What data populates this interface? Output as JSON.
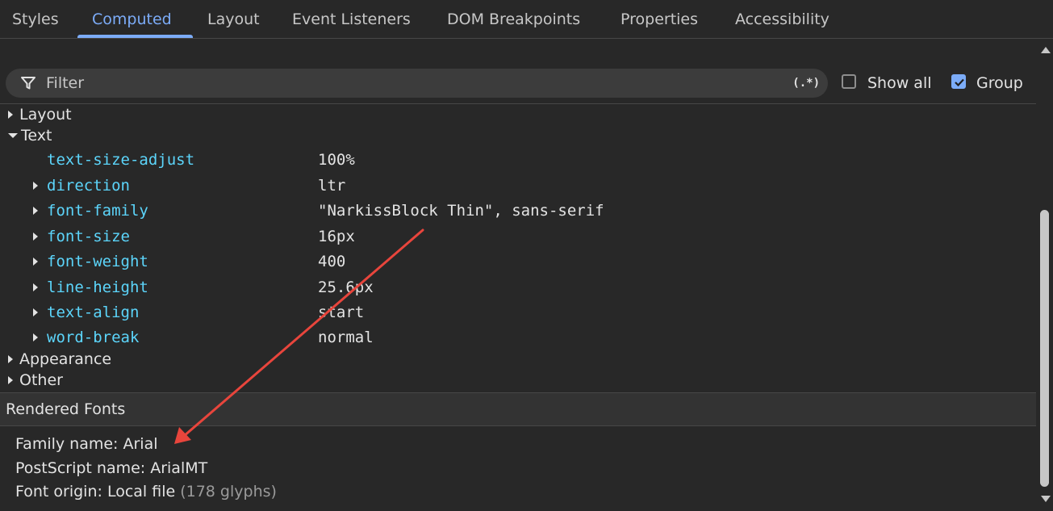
{
  "tabs": [
    {
      "label": "Styles",
      "active": false
    },
    {
      "label": "Computed",
      "active": true
    },
    {
      "label": "Layout",
      "active": false
    },
    {
      "label": "Event Listeners",
      "active": false
    },
    {
      "label": "DOM Breakpoints",
      "active": false
    },
    {
      "label": "Properties",
      "active": false
    },
    {
      "label": "Accessibility",
      "active": false
    }
  ],
  "filter": {
    "placeholder": "Filter",
    "regex_label": "(.*)",
    "filter_icon": "funnel-icon"
  },
  "show_all": {
    "label": "Show all",
    "checked": false
  },
  "group": {
    "label": "Group",
    "checked": true
  },
  "groups": {
    "layout": {
      "label": "Layout",
      "expanded": false
    },
    "text": {
      "label": "Text",
      "expanded": true
    },
    "appearance": {
      "label": "Appearance",
      "expanded": false
    },
    "other": {
      "label": "Other",
      "expanded": false
    }
  },
  "text_properties": [
    {
      "name": "text-size-adjust",
      "value": "100%",
      "expandable": false
    },
    {
      "name": "direction",
      "value": "ltr",
      "expandable": true
    },
    {
      "name": "font-family",
      "value": "\"NarkissBlock Thin\", sans-serif",
      "expandable": true
    },
    {
      "name": "font-size",
      "value": "16px",
      "expandable": true
    },
    {
      "name": "font-weight",
      "value": "400",
      "expandable": true
    },
    {
      "name": "line-height",
      "value": "25.6px",
      "expandable": true
    },
    {
      "name": "text-align",
      "value": "start",
      "expandable": true
    },
    {
      "name": "word-break",
      "value": "normal",
      "expandable": true
    }
  ],
  "rendered_fonts": {
    "title": "Rendered Fonts",
    "family_name": "Family name: Arial",
    "postscript_name": "PostScript name: ArialMT",
    "font_origin": "Font origin: Local file",
    "glyph_count": "(178 glyphs)"
  },
  "colors": {
    "background": "#282828",
    "accent": "#7cacf8",
    "property_name": "#5cd5fb",
    "annotation_arrow": "#e8453c"
  }
}
